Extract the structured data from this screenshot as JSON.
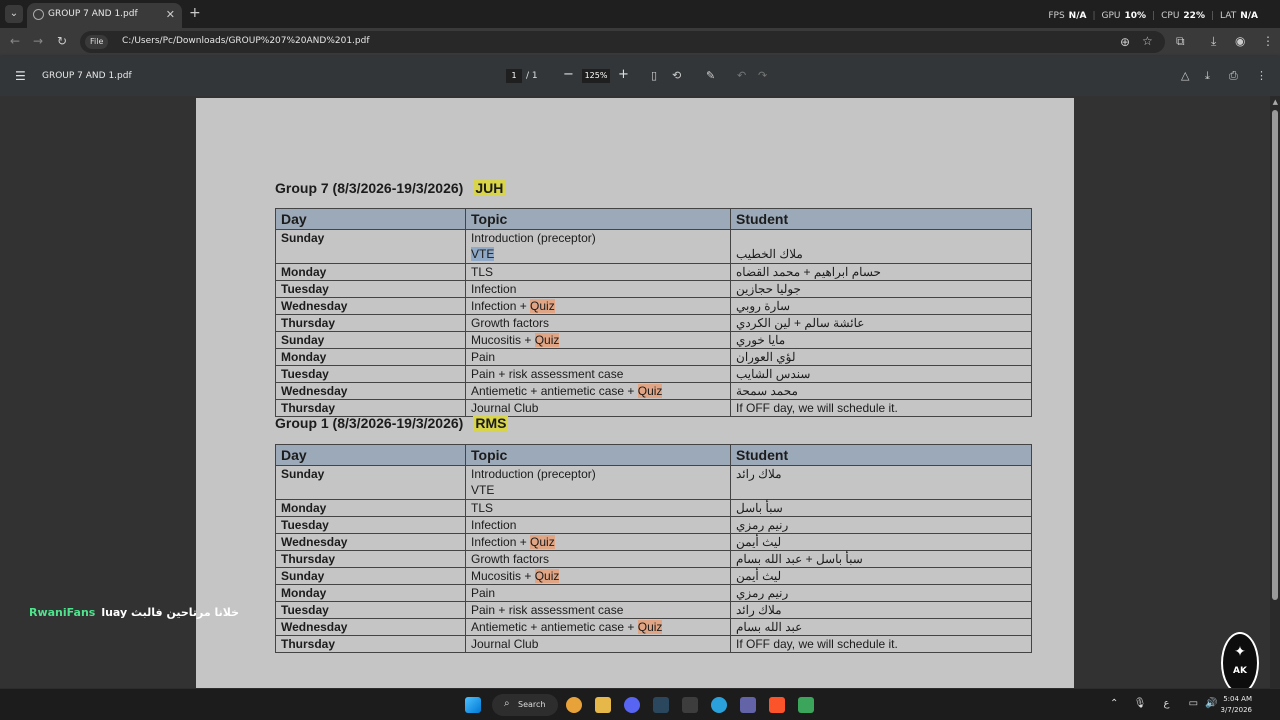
{
  "browser": {
    "tab_title": "GROUP 7 AND 1.pdf",
    "url": "C:/Users/Pc/Downloads/GROUP%207%20AND%201.pdf",
    "file_chip": "File",
    "perf": {
      "fps_label": "FPS",
      "fps_value": "N/A",
      "gpu_label": "GPU",
      "gpu_value": "10%",
      "cpu_label": "CPU",
      "cpu_value": "22%",
      "lat_label": "LAT",
      "lat_value": "N/A"
    }
  },
  "pdf_toolbar": {
    "title": "GROUP 7 AND 1.pdf",
    "page_current": "1",
    "page_total": "/ 1",
    "zoom": "125%"
  },
  "document": {
    "group7": {
      "title": "Group 7 (8/3/2026-19/3/2026)",
      "site": "JUH",
      "headers": [
        "Day",
        "Topic",
        "Student"
      ],
      "rows": [
        {
          "day": "Sunday",
          "topic_line1": "Introduction (preceptor)",
          "topic_line2": "VTE",
          "student": "ملاك الخطيب"
        },
        {
          "day": "Monday",
          "topic": "TLS",
          "student": "حسام ابراهيم + محمد القضاه"
        },
        {
          "day": "Tuesday",
          "topic": "Infection",
          "student": "جوليا حجازين"
        },
        {
          "day": "Wednesday",
          "topic": "Infection + ",
          "quiz": "Quiz",
          "student": "سارة روبي"
        },
        {
          "day": "Thursday",
          "topic": "Growth factors",
          "student": "عائشة سالم + لين الكردي"
        },
        {
          "day": "Sunday",
          "topic": "Mucositis + ",
          "quiz": "Quiz",
          "student": "مايا خوري"
        },
        {
          "day": "Monday",
          "topic": "Pain",
          "student": "لؤي العوران"
        },
        {
          "day": "Tuesday",
          "topic": "Pain + risk assessment case",
          "student": "سندس الشايب"
        },
        {
          "day": "Wednesday",
          "topic": "Antiemetic + antiemetic case + ",
          "quiz": "Quiz",
          "student": "محمد سمحة"
        },
        {
          "day": "Thursday",
          "topic": "Journal Club",
          "student": "If OFF day, we will schedule it."
        }
      ]
    },
    "group1": {
      "title": "Group 1 (8/3/2026-19/3/2026)",
      "site": "RMS",
      "headers": [
        "Day",
        "Topic",
        "Student"
      ],
      "rows": [
        {
          "day": "Sunday",
          "topic_line1": "Introduction (preceptor)",
          "topic_line2": "VTE",
          "student": "ملاك رائد"
        },
        {
          "day": "Monday",
          "topic": "TLS",
          "student": "سبأ باسل"
        },
        {
          "day": "Tuesday",
          "topic": "Infection",
          "student": "رنيم رمزي"
        },
        {
          "day": "Wednesday",
          "topic": "Infection + ",
          "quiz": "Quiz",
          "student": "ليث أيمن"
        },
        {
          "day": "Thursday",
          "topic": "Growth factors",
          "student": "سبأ باسل + عبد الله بسام"
        },
        {
          "day": "Sunday",
          "topic": "Mucositis + ",
          "quiz": "Quiz",
          "student": "ليث أيمن"
        },
        {
          "day": "Monday",
          "topic": "Pain",
          "student": "رنيم رمزي"
        },
        {
          "day": "Tuesday",
          "topic": "Pain + risk assessment case",
          "student": "ملاك رائد"
        },
        {
          "day": "Wednesday",
          "topic": "Antiemetic + antiemetic case + ",
          "quiz": "Quiz",
          "student": "عبد الله بسام"
        },
        {
          "day": "Thursday",
          "topic": "Journal Club",
          "student": "If OFF day, we will schedule it."
        }
      ]
    }
  },
  "overlay": {
    "green_text": "RwaniFans",
    "white_text": "luay خلانا مرتاحين فالبث",
    "logo_text": "AK"
  },
  "taskbar": {
    "search_label": "Search",
    "time": "5:04 AM",
    "date": "3/7/2026",
    "lang": "ع"
  },
  "colors": {
    "page_bg": "#c5c5c5",
    "header_bg": "#9ba9b9",
    "quiz_highlight": "#e0a584",
    "site_highlight": "#d9d54a",
    "overlay_green": "#4ee38c"
  }
}
